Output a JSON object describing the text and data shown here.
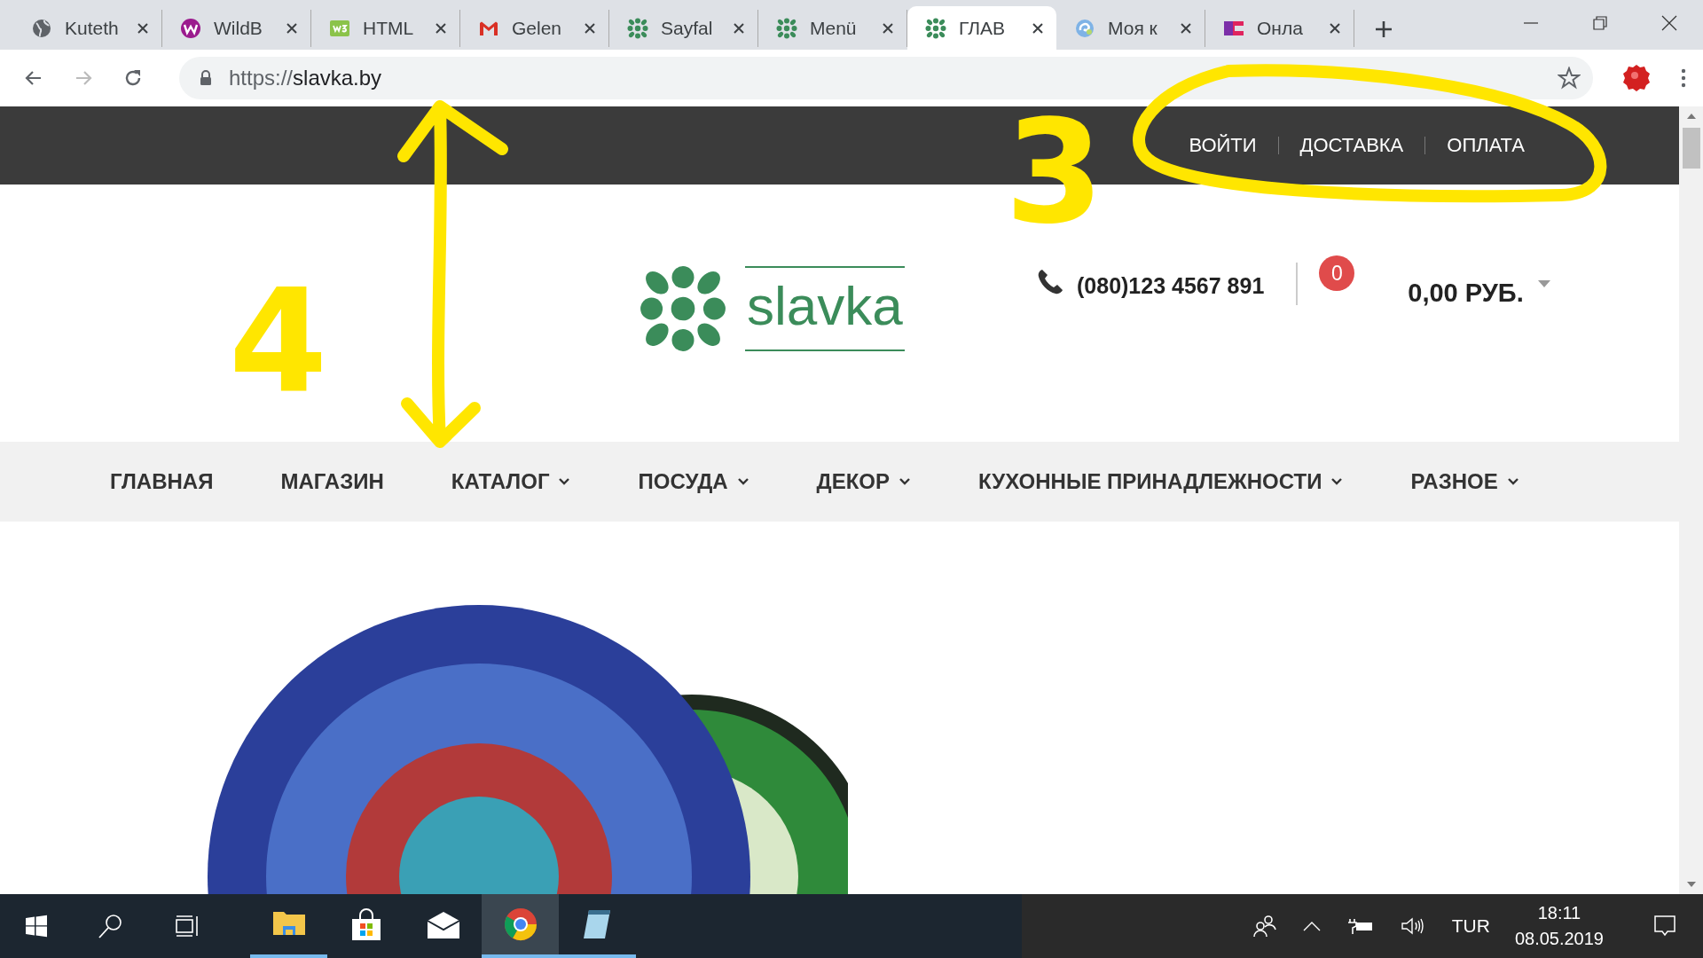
{
  "browser": {
    "tabs": [
      {
        "kind": "globe",
        "title": "Kuteth",
        "selected": false
      },
      {
        "kind": "w-circle",
        "title": "WildB",
        "selected": false
      },
      {
        "kind": "w3",
        "title": "HTML",
        "selected": false
      },
      {
        "kind": "mail",
        "title": "Gelen",
        "selected": false
      },
      {
        "kind": "dots",
        "title": "Sayfal",
        "selected": false
      },
      {
        "kind": "dots",
        "title": "Menü",
        "selected": false
      },
      {
        "kind": "dots",
        "title": "ГЛАВ",
        "selected": true
      },
      {
        "kind": "swirl",
        "title": "Моя к",
        "selected": false
      },
      {
        "kind": "flag",
        "title": "Онла",
        "selected": false
      }
    ],
    "url_scheme": "https://",
    "url_host": "slavka.by"
  },
  "page": {
    "top_links": [
      "ВОЙТИ",
      "ДОСТАВКА",
      "ОПЛАТА"
    ],
    "logo_text": "slavka",
    "phone": "(080)123 4567 891",
    "cart_count": "0",
    "cart_total": "0,00 РУБ.",
    "nav": [
      {
        "label": "ГЛАВНАЯ",
        "dropdown": false
      },
      {
        "label": "МАГАЗИН",
        "dropdown": false
      },
      {
        "label": "КАТАЛОГ",
        "dropdown": true
      },
      {
        "label": "ПОСУДА",
        "dropdown": true
      },
      {
        "label": "ДЕКОР",
        "dropdown": true
      },
      {
        "label": "КУХОННЫЕ ПРИНАДЛЕЖНОСТИ",
        "dropdown": true
      },
      {
        "label": "РАЗНОЕ",
        "dropdown": true
      }
    ]
  },
  "annotations": [
    {
      "kind": "ellipse"
    },
    {
      "kind": "digit",
      "text": "3"
    },
    {
      "kind": "digit",
      "text": "4"
    },
    {
      "kind": "double_arrow"
    }
  ],
  "taskbar": {
    "apps": [
      {
        "kind": "folder",
        "running": true,
        "selected": false
      },
      {
        "kind": "store",
        "running": false,
        "selected": false
      },
      {
        "kind": "mail",
        "running": false,
        "selected": false
      },
      {
        "kind": "chrome",
        "running": true,
        "selected": true
      },
      {
        "kind": "notepad",
        "running": true,
        "selected": false
      }
    ],
    "language": "TUR",
    "time": "18:11",
    "date": "08.05.2019"
  }
}
